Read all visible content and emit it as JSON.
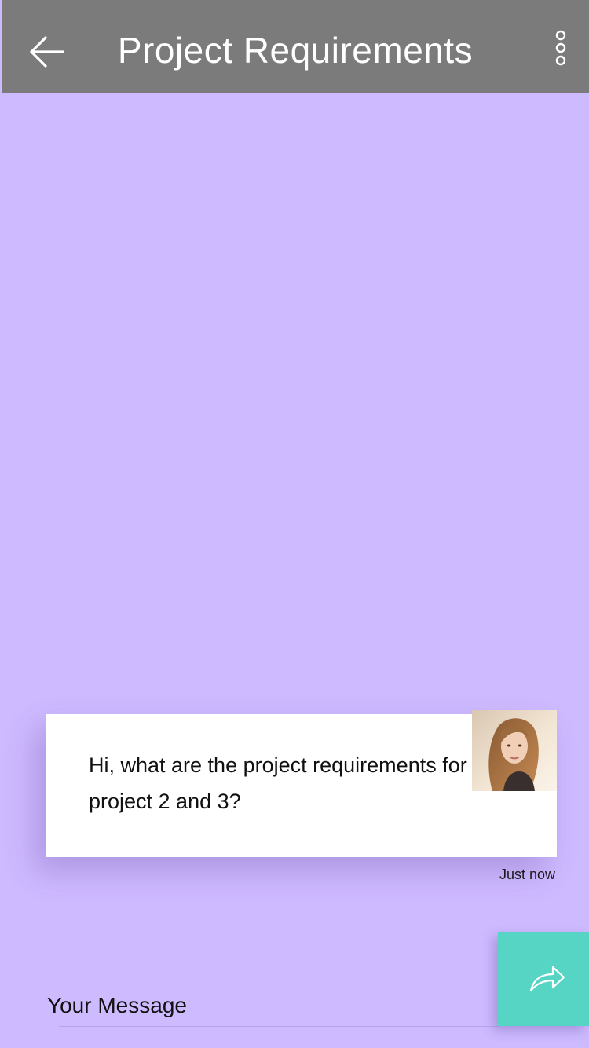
{
  "header": {
    "title": "Project Requirements",
    "back_icon": "arrow-left-icon",
    "more_icon": "more-vertical-icon"
  },
  "conversation": {
    "messages": [
      {
        "text": "Hi, what are the project requirements for project 2 and 3?",
        "timestamp": "Just now",
        "avatar": "user-avatar"
      }
    ]
  },
  "composer": {
    "placeholder": "Your Message",
    "send_icon": "share-forward-icon"
  },
  "colors": {
    "background": "#cebaff",
    "header": "#7b7b7b",
    "send_button": "#56d5c4",
    "card": "#ffffff"
  }
}
